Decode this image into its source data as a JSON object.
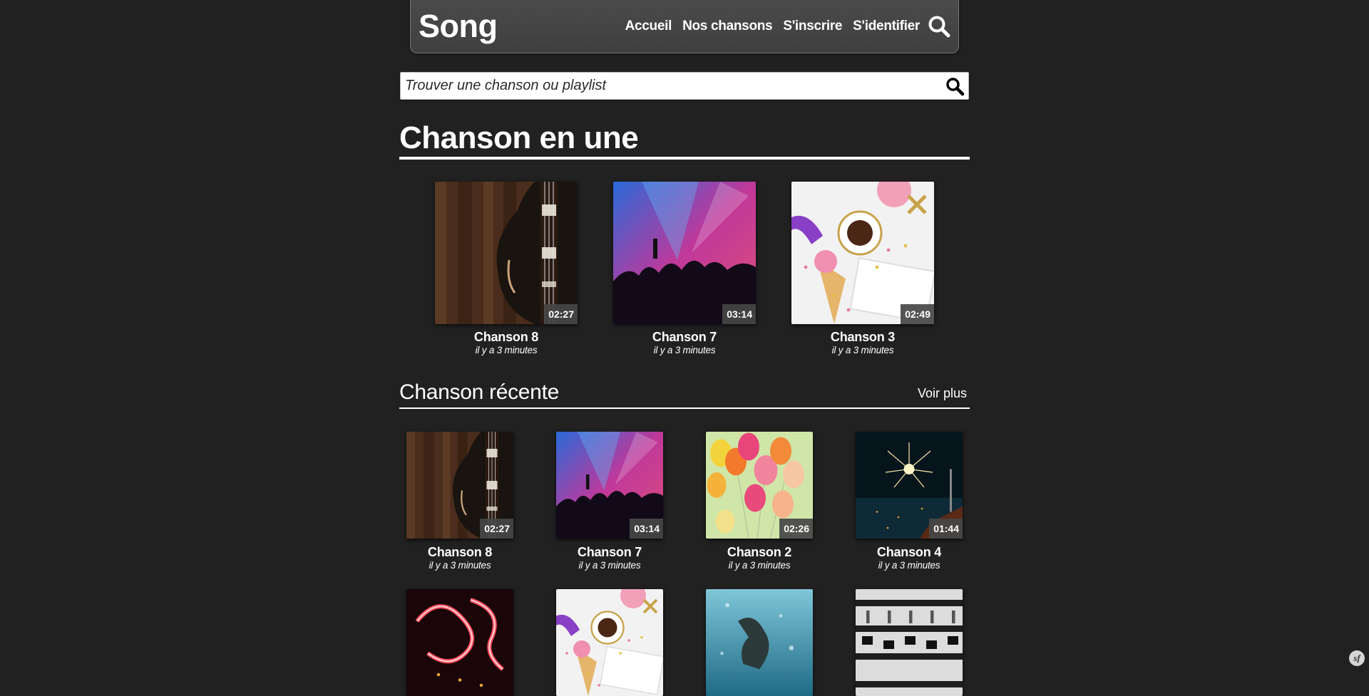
{
  "header": {
    "brand": "Song",
    "nav": [
      "Accueil",
      "Nos chansons",
      "S'inscrire",
      "S'identifier"
    ]
  },
  "search": {
    "placeholder": "Trouver une chanson ou playlist"
  },
  "featured": {
    "title": "Chanson en une",
    "cards": [
      {
        "title": "Chanson 8",
        "subtitle": "il y a 3 minutes",
        "duration": "02:27",
        "image": "guitar"
      },
      {
        "title": "Chanson 7",
        "subtitle": "il y a 3 minutes",
        "duration": "03:14",
        "image": "concert"
      },
      {
        "title": "Chanson 3",
        "subtitle": "il y a 3 minutes",
        "duration": "02:49",
        "image": "party"
      }
    ]
  },
  "recent": {
    "title": "Chanson récente",
    "see_more": "Voir plus",
    "cards": [
      {
        "title": "Chanson 8",
        "subtitle": "il y a 3 minutes",
        "duration": "02:27",
        "image": "guitar"
      },
      {
        "title": "Chanson 7",
        "subtitle": "il y a 3 minutes",
        "duration": "03:14",
        "image": "concert"
      },
      {
        "title": "Chanson 2",
        "subtitle": "il y a 3 minutes",
        "duration": "02:26",
        "image": "balloons"
      },
      {
        "title": "Chanson 4",
        "subtitle": "il y a 3 minutes",
        "duration": "01:44",
        "image": "fireworks"
      },
      {
        "image": "neon"
      },
      {
        "image": "party"
      },
      {
        "image": "underwater"
      },
      {
        "image": "mixer"
      }
    ]
  },
  "colors": {
    "background": "#212121",
    "navbar": "#454545"
  },
  "corner_logo": "sf"
}
